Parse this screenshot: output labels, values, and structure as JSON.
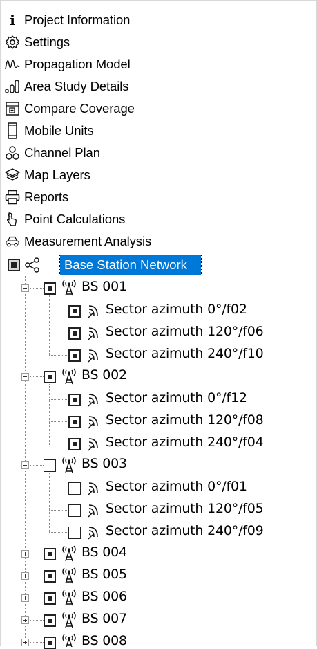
{
  "menu": {
    "project_information": "Project Information",
    "settings": "Settings",
    "propagation_model": "Propagation Model",
    "area_study_details": "Area Study Details",
    "compare_coverage": "Compare Coverage",
    "mobile_units": "Mobile Units",
    "channel_plan": "Channel Plan",
    "map_layers": "Map Layers",
    "reports": "Reports",
    "point_calculations": "Point Calculations",
    "measurement_analysis": "Measurement Analysis"
  },
  "tree": {
    "root_label": "Base Station Network",
    "bs001": {
      "label": "BS 001",
      "s1": "Sector azimuth 0°/f02",
      "s2": "Sector azimuth 120°/f06",
      "s3": "Sector azimuth 240°/f10"
    },
    "bs002": {
      "label": "BS 002",
      "s1": "Sector azimuth 0°/f12",
      "s2": "Sector azimuth 120°/f08",
      "s3": "Sector azimuth 240°/f04"
    },
    "bs003": {
      "label": "BS 003",
      "s1": "Sector azimuth 0°/f01",
      "s2": "Sector azimuth 120°/f05",
      "s3": "Sector azimuth 240°/f09"
    },
    "bs004": "BS 004",
    "bs005": "BS 005",
    "bs006": "BS 006",
    "bs007": "BS 007",
    "bs008": "BS 008"
  },
  "colors": {
    "selection": "#0078d7",
    "tree_lines": "#8a8a8a"
  }
}
